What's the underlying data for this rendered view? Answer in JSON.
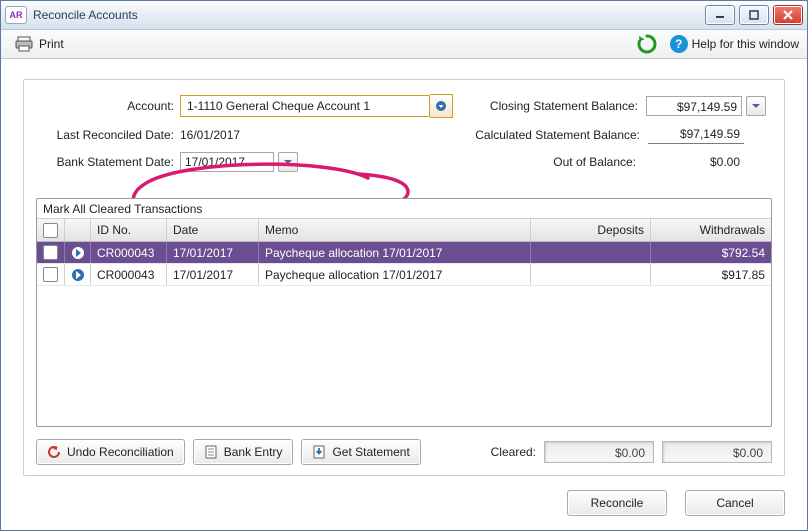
{
  "window": {
    "title": "Reconcile Accounts",
    "app_badge": "AR"
  },
  "toolbar": {
    "print": "Print",
    "help": "Help for this window"
  },
  "fields": {
    "account_label": "Account:",
    "account_value": "1-1110 General Cheque Account 1",
    "last_reconciled_label": "Last Reconciled Date:",
    "last_reconciled_value": "16/01/2017",
    "bank_statement_date_label": "Bank Statement Date:",
    "bank_statement_date_value": "17/01/2017",
    "closing_balance_label": "Closing Statement Balance:",
    "closing_balance_value": "$97,149.59",
    "calculated_balance_label": "Calculated Statement Balance:",
    "calculated_balance_value": "$97,149.59",
    "out_of_balance_label": "Out of Balance:",
    "out_of_balance_value": "$0.00"
  },
  "table": {
    "title": "Mark All Cleared Transactions",
    "headers": {
      "id": "ID No.",
      "date": "Date",
      "memo": "Memo",
      "deposits": "Deposits",
      "withdrawals": "Withdrawals"
    },
    "rows": [
      {
        "selected": true,
        "id": "CR000043",
        "date": "17/01/2017",
        "memo": "Paycheque allocation 17/01/2017",
        "deposits": "",
        "withdrawals": "$792.54"
      },
      {
        "selected": false,
        "id": "CR000043",
        "date": "17/01/2017",
        "memo": "Paycheque allocation 17/01/2017",
        "deposits": "",
        "withdrawals": "$917.85"
      }
    ]
  },
  "panel_buttons": {
    "undo": "Undo Reconciliation",
    "bank_entry": "Bank Entry",
    "get_statement": "Get Statement"
  },
  "cleared": {
    "label": "Cleared:",
    "deposits": "$0.00",
    "withdrawals": "$0.00"
  },
  "dialog_buttons": {
    "reconcile": "Reconcile",
    "cancel": "Cancel"
  }
}
